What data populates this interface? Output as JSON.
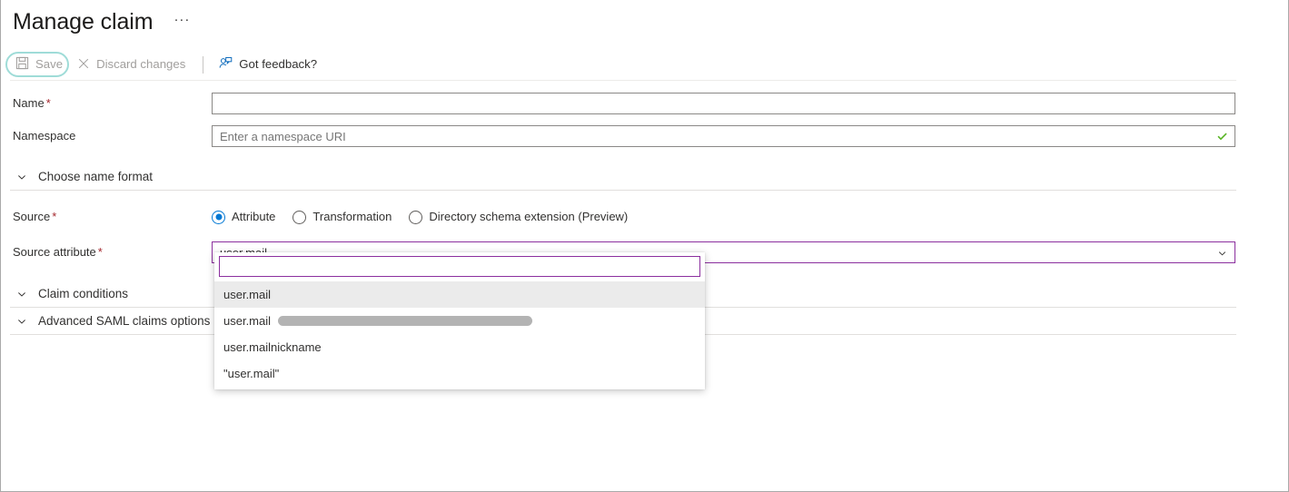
{
  "header": {
    "title": "Manage claim",
    "more_menu": "···"
  },
  "commandbar": {
    "save_label": "Save",
    "save_icon": "save-floppy-icon",
    "save_enabled": false,
    "save_highlighted": true,
    "discard_label": "Discard changes",
    "discard_icon": "close-x-icon",
    "discard_enabled": false,
    "feedback_label": "Got feedback?",
    "feedback_icon": "person-feedback-icon"
  },
  "form": {
    "name": {
      "label": "Name",
      "required": true,
      "value": "",
      "placeholder": ""
    },
    "namespace": {
      "label": "Namespace",
      "required": false,
      "value": "",
      "placeholder": "Enter a namespace URI",
      "validation_icon": "green-checkmark-icon",
      "validation_color": "#5ab526"
    },
    "choose_name_format": {
      "title": "Choose name format",
      "expanded": false,
      "chevron": "chevron-down-icon"
    },
    "source": {
      "label": "Source",
      "required": true,
      "selected": "Attribute",
      "options": [
        "Attribute",
        "Transformation",
        "Directory schema extension (Preview)"
      ]
    },
    "source_attribute": {
      "label": "Source attribute",
      "required": true,
      "value": "user.mail",
      "chevron": "chevron-down-icon",
      "focus_border_color": "#8b2f9e"
    },
    "claim_conditions": {
      "title": "Claim conditions",
      "expanded": false,
      "chevron": "chevron-down-icon"
    },
    "advanced_saml_claims_options": {
      "title": "Advanced SAML claims options",
      "expanded": false,
      "chevron": "chevron-down-icon"
    }
  },
  "dropdown": {
    "open": true,
    "search_value": "",
    "search_placeholder": "",
    "items": [
      {
        "label": "user.mail",
        "selected": true,
        "redacted": false
      },
      {
        "label": "user.mail",
        "selected": false,
        "redacted": true
      },
      {
        "label": "user.mailnickname",
        "selected": false,
        "redacted": false
      },
      {
        "label": "\"user.mail\"",
        "selected": false,
        "redacted": false
      }
    ]
  },
  "colors": {
    "accent_blue": "#0078d4",
    "highlight_teal": "#9fdcd8",
    "required_red": "#a4262c",
    "focus_purple": "#8b2f9e",
    "success_green": "#5ab526",
    "disabled_gray": "#a19f9d"
  }
}
